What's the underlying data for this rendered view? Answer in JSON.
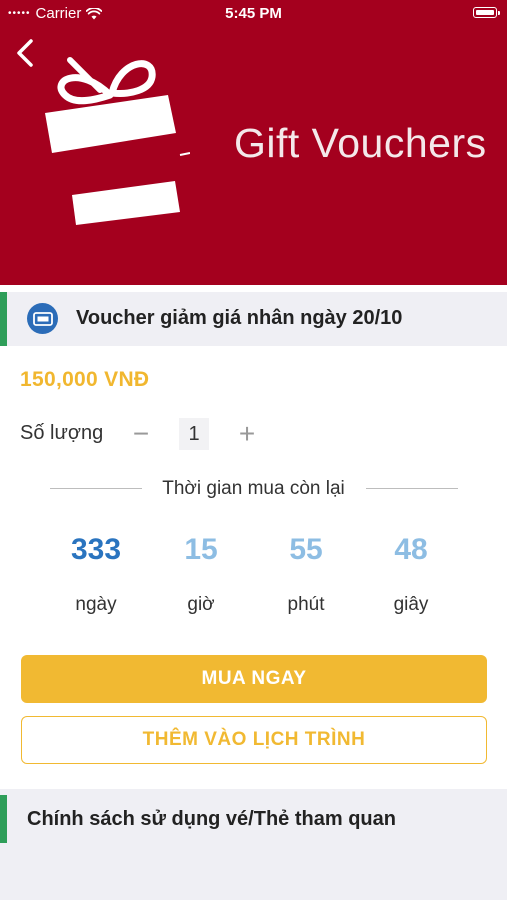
{
  "status_bar": {
    "carrier": "Carrier",
    "time": "5:45 PM"
  },
  "header": {
    "banner_title": "Gift Vouchers",
    "banner_color": "#a4001e"
  },
  "voucher": {
    "title": "Voucher giảm giá nhân ngày 20/10",
    "price": "150,000 VNĐ",
    "quantity_label": "Số lượng",
    "quantity_minus": "−",
    "quantity_value": "1",
    "quantity_plus": "+"
  },
  "countdown": {
    "heading": "Thời gian mua còn lại",
    "days": "333",
    "days_label": "ngày",
    "hours": "15",
    "hours_label": "giờ",
    "minutes": "55",
    "minutes_label": "phút",
    "seconds": "48",
    "seconds_label": "giây",
    "primary_color": "#2a74bf",
    "secondary_color": "#8dbde3"
  },
  "actions": {
    "buy_label": "MUA NGAY",
    "schedule_label": "THÊM VÀO LỊCH TRÌNH",
    "accent_color": "#f1b932"
  },
  "policy": {
    "title": "Chính sách sử dụng vé/Thẻ tham quan"
  },
  "icons": {
    "back": "chevron-left-icon",
    "voucher": "ticket-icon",
    "wifi": "wifi-icon",
    "battery": "battery-icon",
    "gift": "gift-box-icon"
  }
}
